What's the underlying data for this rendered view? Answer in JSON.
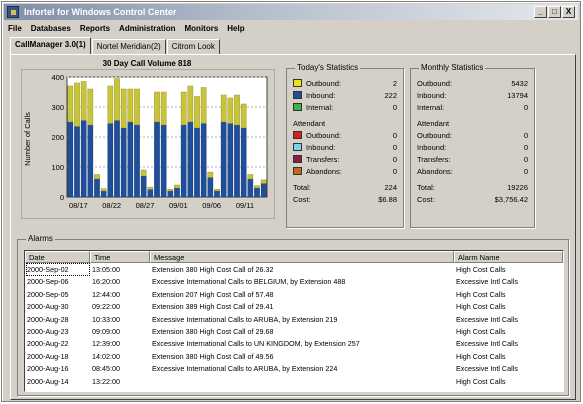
{
  "window": {
    "title": "Infortel for Windows Control Center",
    "minimize": "_",
    "maximize": "□",
    "close": "X"
  },
  "menu": [
    "File",
    "Databases",
    "Reports",
    "Administration",
    "Monitors",
    "Help"
  ],
  "tabs": [
    "CallManager 3.0(1)",
    "Nortel Meridian(2)",
    "Citrom Look"
  ],
  "chart": {
    "title": "30 Day Call Volume 818",
    "ylabel": "Number of Calls",
    "yticks": [
      "400",
      "300",
      "200",
      "100",
      "0"
    ],
    "xticks": [
      "08/17",
      "08/22",
      "08/27",
      "09/01",
      "09/06",
      "09/11"
    ]
  },
  "chart_data": {
    "type": "bar",
    "stacked": true,
    "title": "30 Day Call Volume 818",
    "ylabel": "Number of Calls",
    "ylim": [
      0,
      400
    ],
    "categories": [
      "08/17",
      "08/18",
      "08/19",
      "08/20",
      "08/21",
      "08/22",
      "08/23",
      "08/24",
      "08/25",
      "08/26",
      "08/27",
      "08/28",
      "08/29",
      "08/30",
      "08/31",
      "09/01",
      "09/02",
      "09/03",
      "09/04",
      "09/05",
      "09/06",
      "09/07",
      "09/08",
      "09/09",
      "09/10",
      "09/11",
      "09/12",
      "09/13",
      "09/14",
      "09/15"
    ],
    "series": [
      {
        "name": "Inbound",
        "color": "#1f4e9a",
        "values": [
          250,
          235,
          255,
          240,
          60,
          20,
          245,
          255,
          230,
          250,
          240,
          70,
          25,
          250,
          240,
          20,
          30,
          240,
          250,
          230,
          245,
          65,
          20,
          250,
          245,
          240,
          230,
          60,
          30,
          45
        ]
      },
      {
        "name": "Outbound",
        "color": "#c8c43a",
        "values": [
          120,
          145,
          130,
          120,
          15,
          8,
          125,
          140,
          130,
          110,
          120,
          20,
          8,
          100,
          110,
          6,
          10,
          110,
          120,
          105,
          120,
          18,
          6,
          90,
          85,
          100,
          80,
          15,
          8,
          12
        ]
      }
    ]
  },
  "today": {
    "label": "Today's Statistics",
    "rows": [
      {
        "label": "Outbound:",
        "value": "2",
        "color": "#e8e020"
      },
      {
        "label": "Inbound:",
        "value": "222",
        "color": "#1f4e9a"
      },
      {
        "label": "Internal:",
        "value": "0",
        "color": "#3bb24a"
      }
    ],
    "attendant_label": "Attendant",
    "attendant_rows": [
      {
        "label": "Outbound:",
        "value": "0",
        "color": "#d02020"
      },
      {
        "label": "Inbound:",
        "value": "0",
        "color": "#7fd0e8"
      },
      {
        "label": "Transfers:",
        "value": "0",
        "color": "#8a1e3e"
      },
      {
        "label": "Abandons:",
        "value": "0",
        "color": "#c06a18"
      }
    ],
    "total_label": "Total:",
    "total": "224",
    "cost_label": "Cost:",
    "cost": "$6.88"
  },
  "monthly": {
    "label": "Monthly Statistics",
    "rows": [
      {
        "label": "Outbound:",
        "value": "5432"
      },
      {
        "label": "Inbound:",
        "value": "13794"
      },
      {
        "label": "Internal:",
        "value": "0"
      }
    ],
    "attendant_label": "Attendant",
    "attendant_rows": [
      {
        "label": "Outbound:",
        "value": "0"
      },
      {
        "label": "Inbound:",
        "value": "0"
      },
      {
        "label": "Transfers:",
        "value": "0"
      },
      {
        "label": "Abandons:",
        "value": "0"
      }
    ],
    "total_label": "Total:",
    "total": "19226",
    "cost_label": "Cost:",
    "cost": "$3,756.42"
  },
  "alarms": {
    "label": "Alarms",
    "columns": [
      "Date",
      "Time",
      "Message",
      "Alarm Name"
    ],
    "rows": [
      {
        "date": "2000-Sep-02",
        "time": "13:05:00",
        "message": "Extension 380 High Cost Call of 26.32",
        "alarm": "High Cost Calls",
        "selected": true
      },
      {
        "date": "2000-Sep-06",
        "time": "16:20:00",
        "message": "Excessive International Calls to BELGIUM,   by Extension 488",
        "alarm": "Excessive Intl Calls"
      },
      {
        "date": "2000-Sep-05",
        "time": "12:44:00",
        "message": "Extension 207 High Cost Call of 57.48",
        "alarm": "High Cost Calls"
      },
      {
        "date": "2000-Aug-30",
        "time": "09:22:00",
        "message": "Extension 389 High Cost Call of 29.41",
        "alarm": "High Cost Calls"
      },
      {
        "date": "2000-Aug-28",
        "time": "10:33:00",
        "message": "Excessive International Calls to ARUBA,   by Extension 219",
        "alarm": "Excessive Intl Calls"
      },
      {
        "date": "2000-Aug-23",
        "time": "09:09:00",
        "message": "Extension 380 High Cost Call of 29.68",
        "alarm": "High Cost Calls"
      },
      {
        "date": "2000-Aug-22",
        "time": "12:39:00",
        "message": "Excessive International Calls to UN KINGDOM,   by Extension 257",
        "alarm": "Excessive Intl Calls"
      },
      {
        "date": "2000-Aug-18",
        "time": "14:02:00",
        "message": "Extension 380 High Cost Call of 49.56",
        "alarm": "High Cost Calls"
      },
      {
        "date": "2000-Aug-16",
        "time": "08:45:00",
        "message": "Excessive International Calls to ARUBA,   by Extension 224",
        "alarm": "Excessive Intl Calls"
      },
      {
        "date": "2000-Aug-14",
        "time": "13:22:00",
        "message": "",
        "alarm": "High Cost Calls"
      }
    ]
  }
}
